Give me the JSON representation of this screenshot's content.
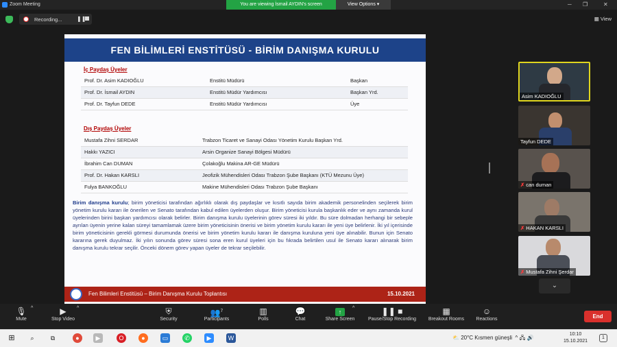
{
  "window": {
    "title": "Zoom Meeting",
    "viewing_banner": "You are viewing İsmail AYDIN's screen",
    "view_options": "View Options",
    "minimize": "─",
    "restore": "❐",
    "close": "✕"
  },
  "recording": {
    "label": "Recording...",
    "pause": "❚❚",
    "view_label": "View"
  },
  "slide": {
    "title": "FEN BİLİMLERİ ENSTİTÜSÜ - BİRİM DANIŞMA KURULU",
    "internal_heading": "İç Paydaş Üyeler",
    "internal_members": [
      {
        "name": "Prof. Dr. Asim KADIOĞLU",
        "position": "Enstitü Müdürü",
        "role": "Başkan"
      },
      {
        "name": "Prof. Dr. İsmail AYDIN",
        "position": "Enstitü Müdür Yardımcısı",
        "role": "Başkan Yrd."
      },
      {
        "name": "Prof. Dr. Tayfun DEDE",
        "position": "Enstitü Müdür Yardımcısı",
        "role": "Üye"
      }
    ],
    "external_heading": "Dış Paydaş Üyeler",
    "external_members": [
      {
        "name": "Mustafa Zihni SERDAR",
        "org": "Trabzon Ticaret ve Sanayi Odası Yönetim Kurulu Başkan Yrd."
      },
      {
        "name": "Hakkı YAZICI",
        "org": "Arsin Organize Sanayi Bölgesi Müdürü"
      },
      {
        "name": "İbrahim Can DUMAN",
        "org": "Çolakoğlu Makina AR-GE Müdürü"
      },
      {
        "name": "Prof. Dr. Hakan KARSLI",
        "org": "Jeofizik Mühendisleri Odası Trabzon Şube Başkanı (KTÜ Mezunu Üye)"
      },
      {
        "name": "Fulya BANKOĞLU",
        "org": "Makine Mühendisleri Odası Trabzon Şube Başkanı"
      }
    ],
    "para_lead": "Birim danışma kurulu",
    "para_body": "; birim yöneticisi tarafından ağırlıklı olarak dış paydaşlar ve kısıtlı sayıda birim akademik personelinden seçilerek birim yönetim kurulu kararı ile önerilen ve Senato tarafından kabul edilen üyelerden oluşur. Birim yöneticisi kurula başkanlık eder ve aynı zamanda kurul üyelerinden birini başkan yardımcısı olarak belirler. Birim danışma kurulu üyelerinin görev süresi iki yıldır. Bu süre dolmadan herhangi bir sebeple ayrılan üyenin yerine kalan süreyi tamamlamak üzere birim yöneticisinin önerisi ve birim yönetim kurulu kararı ile yeni üye belirlenir. İki yıl içerisinde birim yöneticisinin gerekli görmesi durumunda önerisi ve birim yönetim kurulu kararı ile danışma kuruluna yeni üye alınabilir. Bunun için Senato kararına gerek duyulmaz. İki yılın sonunda görev süresi sona eren kurul üyeleri için bu fıkrada belirtilen usul ile Senato kararı alınarak birim danışma kurulu tekrar seçilir. Önceki dönem görev yapan üyeler de tekrar seçilebilir.",
    "footer_text": "Fen Bilimleri Enstitüsü – Birim Danışma Kurulu Toplantısı",
    "footer_date": "15.10.2021"
  },
  "participants": [
    {
      "name": "Asim KADIOĞLU",
      "muted": false,
      "active": true
    },
    {
      "name": "Tayfun DEDE",
      "muted": false,
      "active": false
    },
    {
      "name": "can duman",
      "muted": true,
      "active": false
    },
    {
      "name": "HAKAN KARSLI",
      "muted": true,
      "active": false
    },
    {
      "name": "Mustafa Zihni Şerdar",
      "muted": true,
      "active": false
    }
  ],
  "participants_more": "⌄",
  "toolbar": {
    "mute": "Mute",
    "stop_video": "Stop Video",
    "security": "Security",
    "participants": "Participants",
    "participants_count": "7",
    "polls": "Polls",
    "chat": "Chat",
    "share_screen": "Share Screen",
    "pause_recording": "Pause/Stop Recording",
    "breakout": "Breakout Rooms",
    "reactions": "Reactions",
    "end": "End"
  },
  "taskbar": {
    "weather": "20°C  Kısmen güneşli",
    "time": "10:10",
    "date": "15.10.2021",
    "notif_count": "1"
  },
  "colors": {
    "slide_title_bg": "#1d4389",
    "footer_bg": "#ad2317",
    "active_speaker": "#e0d61e",
    "share_green": "#23a344",
    "end_red": "#d9302c"
  }
}
